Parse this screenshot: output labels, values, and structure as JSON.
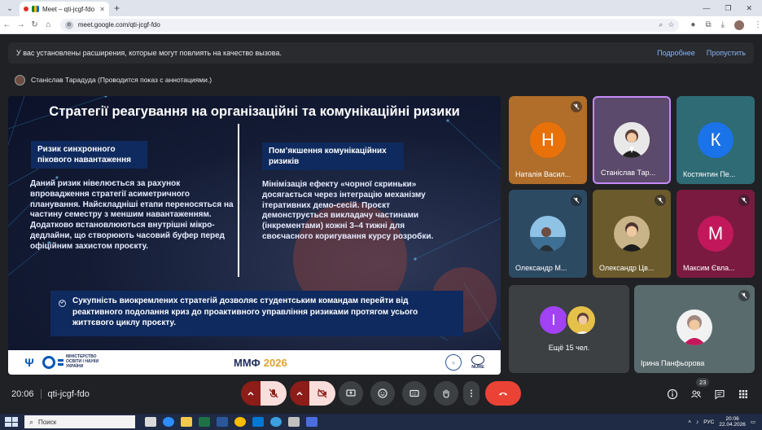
{
  "browser": {
    "tab_title": "Meet – qti-jcgf-fdo",
    "url": "meet.google.com/qti-jcgf-fdo"
  },
  "extension_bar": {
    "text": "У вас установлены расширения, которые могут повлиять на качество вызова.",
    "more_link": "Подробнее",
    "skip_link": "Пропустить"
  },
  "presenter": {
    "text": "Станіслав Тарадуда (Проводится показ с аннотациями.)"
  },
  "slide": {
    "title": "Стратегії реагування на організаційні та комунікаційні ризики",
    "left_heading": "Ризик синхронного пікового навантаження",
    "left_body": "Даний ризик нівелюється за рахунок впровадження стратегії асиметричного планування. Найскладніші етапи переносяться на частину семестру з меншим навантаженням. Додатково встановлюються внутрішні мікро-дедлайни, що створюють часовий буфер перед офіційним захистом проєкту.",
    "right_heading": "Пом’якшення комунікаційних ризиків",
    "right_body": "Мінімізація ефекту «чорної скриньки» досягається через інтеграцію механізму ітеративних демо-сесій. Проєкт демонструється викладачу частинами (інкрементами) кожні 3–4 тижні для своєчасного коригування курсу розробки.",
    "summary": "Сукупність виокремлених стратегій дозволяє студентським командам перейти від реактивного подолання криз до проактивного управління ризиками протягом усього життєвого циклу проєкту.",
    "footer": {
      "ministry": "МІНІСТЕРСТВО ОСВІТИ І НАУКИ УКРАЇНИ",
      "conf_name": "ММФ",
      "conf_year": "2026",
      "nure": "NURE"
    }
  },
  "participants": [
    {
      "name": "Наталія Васил...",
      "initial": "Н",
      "avatar_color": "#e8710a",
      "muted": true
    },
    {
      "name": "Станіслав Тар...",
      "initial": "",
      "avatar_color": "#4e342e",
      "muted": false,
      "active": true
    },
    {
      "name": "Костянтин Пе...",
      "initial": "К",
      "avatar_color": "#1a73e8",
      "muted": false
    },
    {
      "name": "Олександр М...",
      "initial": "",
      "avatar_color": "#546e7a",
      "muted": true
    },
    {
      "name": "Олександр Цв...",
      "initial": "",
      "avatar_color": "#8d6e63",
      "muted": true
    },
    {
      "name": "Максим Євла...",
      "initial": "М",
      "avatar_color": "#c2185b",
      "muted": true
    }
  ],
  "more_tile": {
    "label": "Ещё 15 чел.",
    "initial": "I"
  },
  "irina_tile": {
    "name": "Ірина Панфьорова",
    "muted": true
  },
  "meeting": {
    "time": "20:06",
    "code": "qti-jcgf-fdo",
    "participants_count": "23"
  },
  "taskbar": {
    "search_placeholder": "Поиск",
    "lang": "РУС",
    "clock_time": "20:06",
    "clock_date": "22.04.2026"
  },
  "colors": {
    "meet_bg": "#202124",
    "end_call": "#ea4335",
    "muted_ctrl": "#f9dedc",
    "slide_box": "#0f2a5e",
    "active_border": "#c58af9"
  }
}
